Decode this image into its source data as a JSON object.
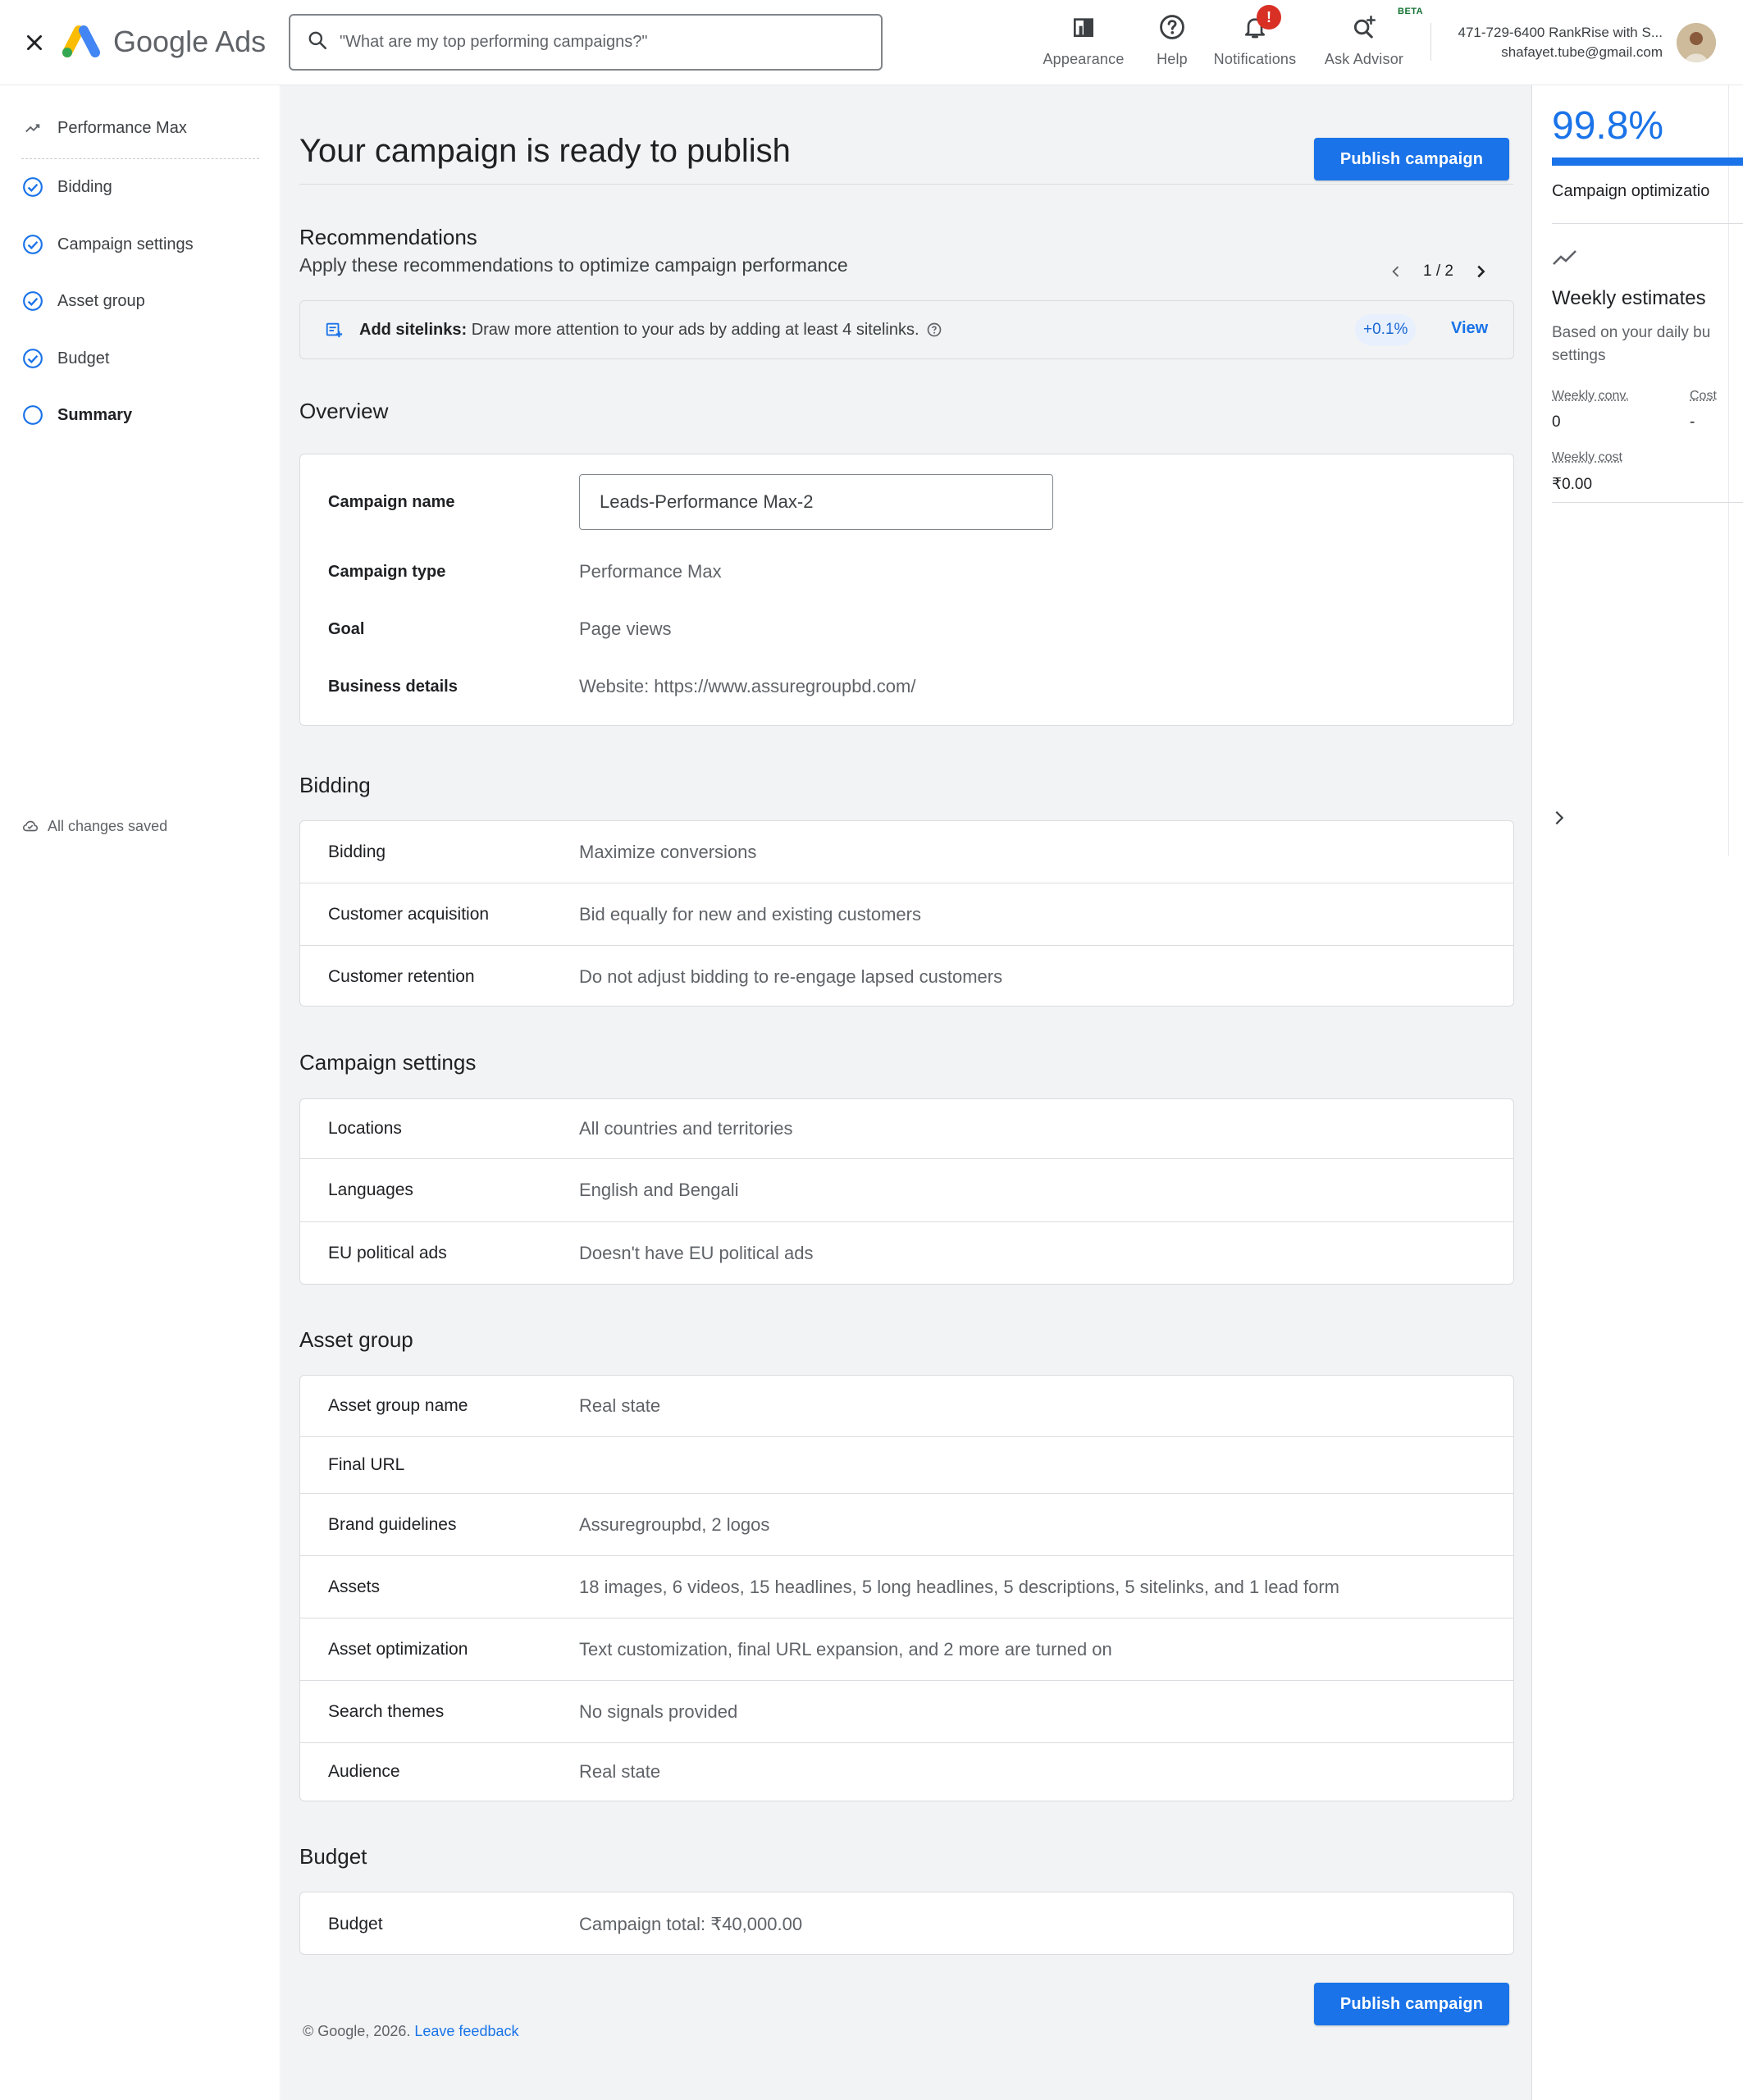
{
  "app": {
    "brand": "Google Ads",
    "search_placeholder": "\"What are my top performing campaigns?\"",
    "tools": [
      {
        "label": "Appearance",
        "icon": "appearance-icon"
      },
      {
        "label": "Help",
        "icon": "help-icon"
      },
      {
        "label": "Notifications",
        "icon": "bell-icon",
        "badge": "!"
      },
      {
        "label": "Ask Advisor",
        "icon": "ask-advisor-icon",
        "tag": "BETA"
      }
    ],
    "account_line1": "471-729-6400 RankRise with S...",
    "account_line2": "shafayet.tube@gmail.com"
  },
  "nav": {
    "items": [
      {
        "label": "Performance Max",
        "icon": "performance-max-icon"
      },
      {
        "label": "Bidding",
        "icon": "check-circle-icon"
      },
      {
        "label": "Campaign settings",
        "icon": "check-circle-icon"
      },
      {
        "label": "Asset group",
        "icon": "check-circle-icon"
      },
      {
        "label": "Budget",
        "icon": "check-circle-icon"
      },
      {
        "label": "Summary",
        "icon": "empty-circle-icon"
      }
    ],
    "saved_status": "All changes saved"
  },
  "main": {
    "title": "Your campaign is ready to publish",
    "publish_label": "Publish campaign",
    "recommendations": {
      "heading": "Recommendations",
      "subtitle": "Apply these recommendations to optimize campaign performance",
      "page": "1 / 2",
      "item_title": "Add sitelinks:",
      "item_text": "Draw more attention to your ads by adding at least 4 sitelinks.",
      "uplift": "+0.1%",
      "view_label": "View"
    },
    "overview": {
      "heading": "Overview",
      "name_label": "Campaign name",
      "name_value": "Leads-Performance Max-2",
      "rows": [
        {
          "label": "Campaign type",
          "value": "Performance Max"
        },
        {
          "label": "Goal",
          "value": "Page views"
        },
        {
          "label": "Business details",
          "value": "Website:  https://www.assuregroupbd.com/"
        }
      ]
    },
    "bidding": {
      "heading": "Bidding",
      "rows": [
        {
          "label": "Bidding",
          "value": "Maximize conversions"
        },
        {
          "label": "Customer acquisition",
          "value": "Bid equally for new and existing customers"
        },
        {
          "label": "Customer retention",
          "value": "Do not adjust bidding to re-engage lapsed customers"
        }
      ]
    },
    "campaign_settings": {
      "heading": "Campaign settings",
      "rows": [
        {
          "label": "Locations",
          "value": "All countries and territories"
        },
        {
          "label": "Languages",
          "value": "English and Bengali"
        },
        {
          "label": "EU political ads",
          "value": "Doesn't have EU political ads"
        }
      ]
    },
    "asset_group": {
      "heading": "Asset group",
      "rows": [
        {
          "label": "Asset group name",
          "value": "Real state"
        },
        {
          "label": "Final URL",
          "value": ""
        },
        {
          "label": "Brand guidelines",
          "value": "Assuregroupbd, 2 logos"
        },
        {
          "label": "Assets",
          "value": "18 images, 6 videos, 15 headlines, 5 long headlines, 5 descriptions, 5 sitelinks, and 1 lead form"
        },
        {
          "label": "Asset optimization",
          "value": "Text customization, final URL expansion, and 2 more are turned on"
        },
        {
          "label": "Search themes",
          "value": "No signals provided"
        },
        {
          "label": "Audience",
          "value": "Real state"
        }
      ]
    },
    "budget": {
      "heading": "Budget",
      "rows": [
        {
          "label": "Budget",
          "value": "Campaign total: ₹40,000.00"
        }
      ]
    },
    "footer": {
      "copyright": "© Google, 2026.",
      "feedback": "Leave feedback"
    }
  },
  "panel": {
    "optimization_score": "99.8%",
    "optimization_fraction": 0.998,
    "optimization_label": "Campaign optimizatio",
    "weekly_heading": "Weekly estimates",
    "based_line1": "Based on your daily bu",
    "based_line2": "settings",
    "weekly_conv_label": "Weekly conv.",
    "weekly_conv_value": "0",
    "cost_label": "Cost",
    "cost_value": "-",
    "weekly_cost_label": "Weekly cost",
    "weekly_cost_value": "₹0.00"
  },
  "colors": {
    "accent": "#1a73e8",
    "alert": "#d93025",
    "page_bg": "#f1f3f4"
  }
}
